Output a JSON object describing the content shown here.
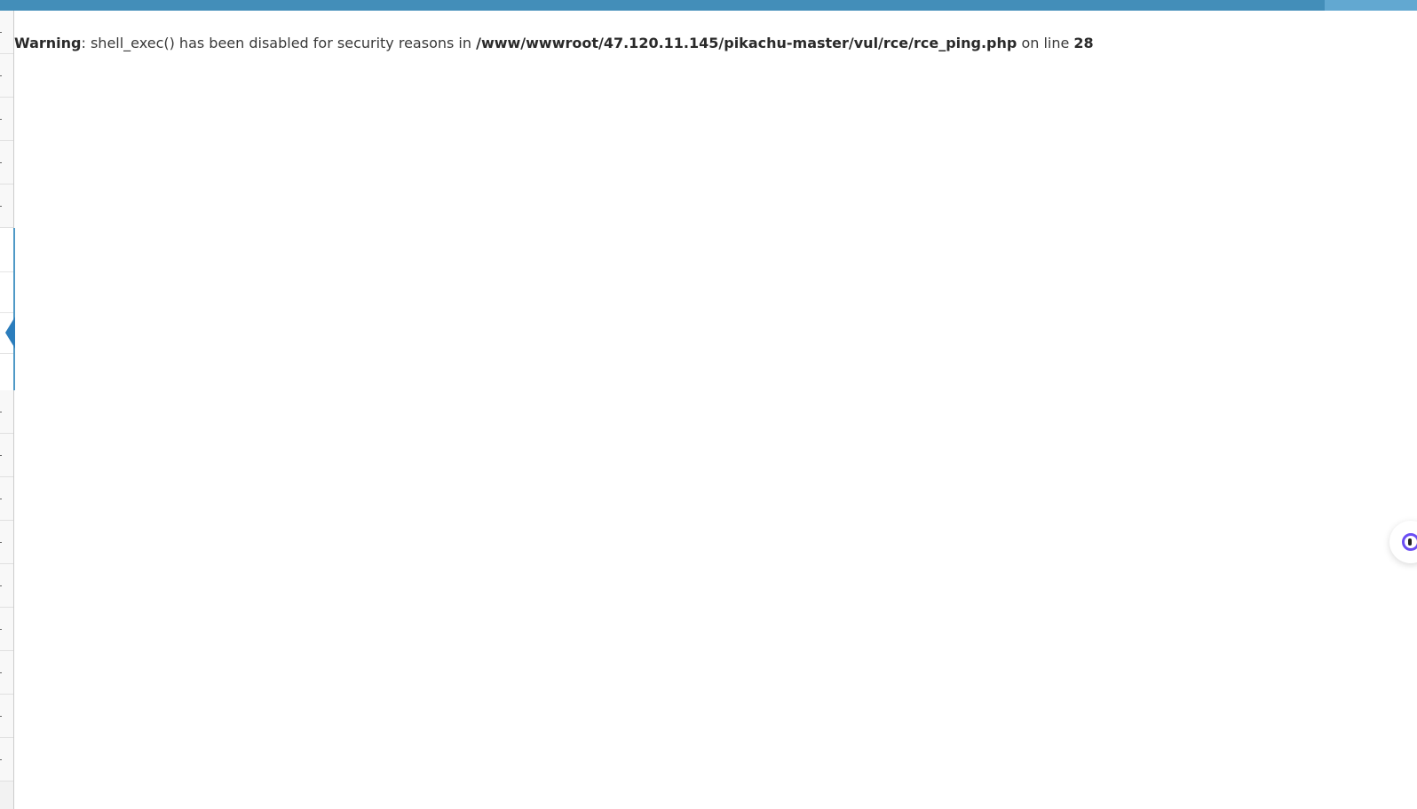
{
  "warning": {
    "label": "Warning",
    "sep": ": ",
    "message": "shell_exec() has been disabled for security reasons in ",
    "path": "/www/wwwroot/47.120.11.145/pikachu-master/vul/rce/rce_ping.php",
    "line_text": " on line ",
    "line_number": "28"
  },
  "icons": {
    "avatar": "user-avatar-icon",
    "sidebar_arrow": "active-menu-arrow-icon",
    "assistant": "assistant-widget-icon"
  },
  "colors": {
    "navbar": "#438eb9",
    "navbar_right": "#62a8d1",
    "sidebar_active": "#2b7dbc",
    "sidebar_border": "#4f99c6",
    "assistant_ring": "#6a4df4"
  }
}
